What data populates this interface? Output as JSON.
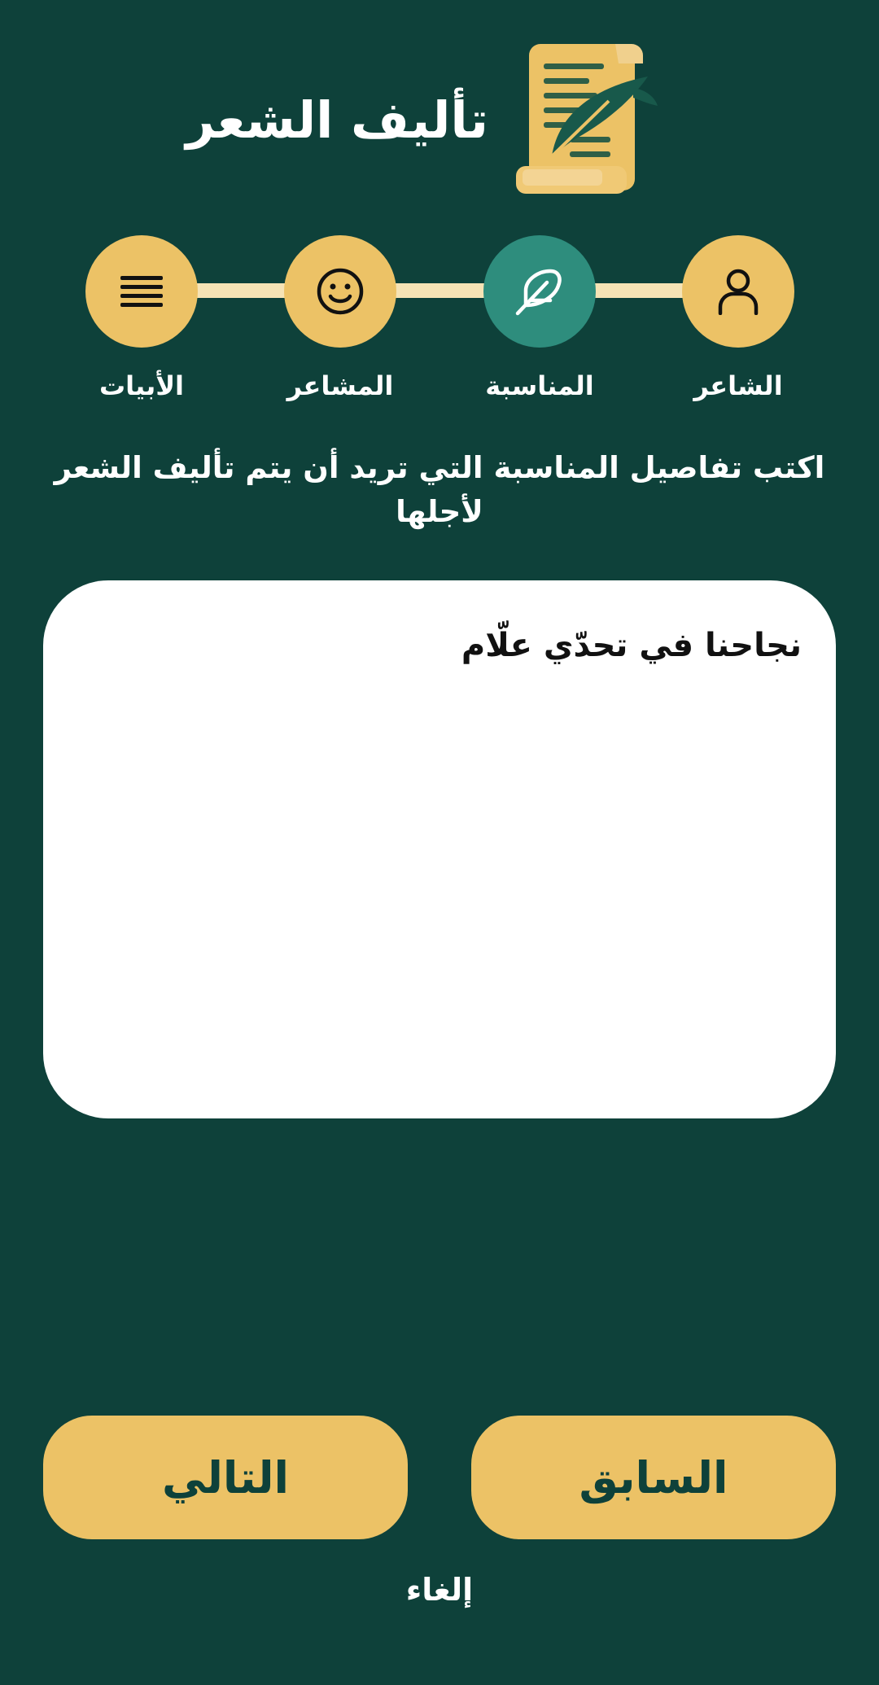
{
  "app": {
    "title": "تأليف الشعر",
    "logo_icon": "scroll-quill-icon"
  },
  "colors": {
    "background": "#0e413a",
    "accent": "#ecc266",
    "active_step": "#2e8d7d",
    "connector": "#f6e3b5",
    "input_background": "#ffffff"
  },
  "stepper": {
    "current_step_index": 1,
    "steps": [
      {
        "label": "الشاعر",
        "icon": "person-icon",
        "state": "done"
      },
      {
        "label": "المناسبة",
        "icon": "feather-icon",
        "state": "active"
      },
      {
        "label": "المشاعر",
        "icon": "smiley-icon",
        "state": "pending"
      },
      {
        "label": "الأبيات",
        "icon": "lines-icon",
        "state": "pending"
      }
    ]
  },
  "main": {
    "instruction": "اكتب تفاصيل المناسبة التي تريد أن يتم تأليف الشعر لأجلها",
    "occasion_value": "نجاحنا في تحدّي علّام"
  },
  "footer": {
    "previous_label": "السابق",
    "next_label": "التالي",
    "cancel_label": "إلغاء"
  }
}
